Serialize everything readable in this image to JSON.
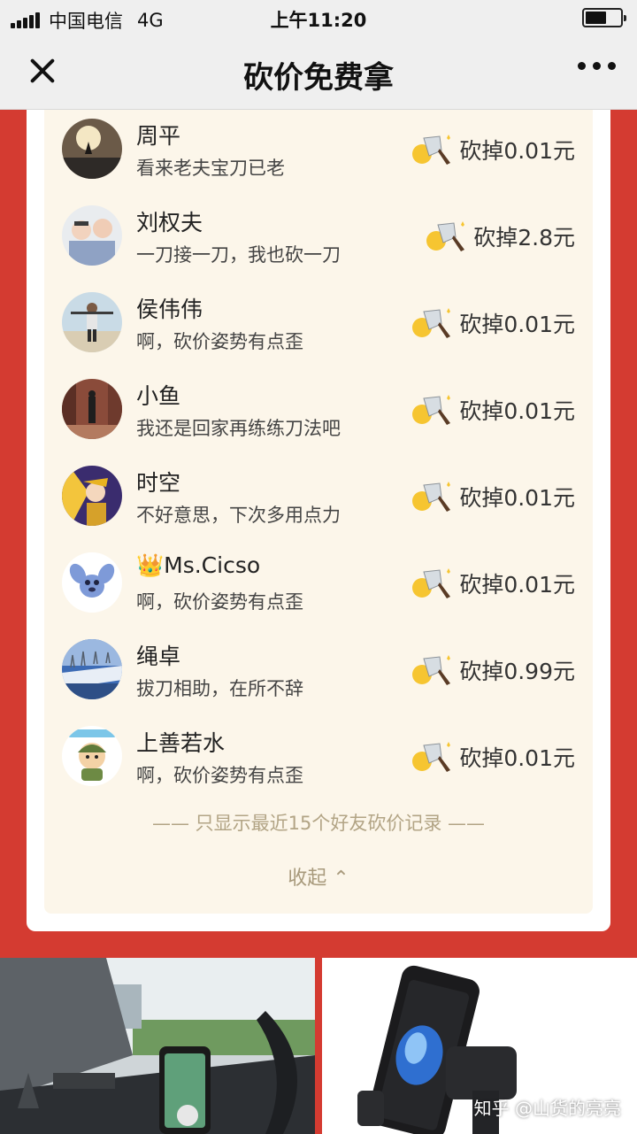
{
  "status_bar": {
    "carrier": "中国电信",
    "network": "4G",
    "time": "上午11:20",
    "battery_level": 0.6
  },
  "nav": {
    "title": "砍价免费拿"
  },
  "records": [
    {
      "name": "周平",
      "comment": "看来老夫宝刀已老",
      "cut": "砍掉0.01元",
      "avatar": "avatar-sunset"
    },
    {
      "name": "刘权夫",
      "comment": "一刀接一刀，我也砍一刀",
      "cut": "砍掉2.8元",
      "avatar": "avatar-kids"
    },
    {
      "name": "侯伟伟",
      "comment": "啊，砍价姿势有点歪",
      "cut": "砍掉0.01元",
      "avatar": "avatar-beach"
    },
    {
      "name": "小鱼",
      "comment": "我还是回家再练练刀法吧",
      "cut": "砍掉0.01元",
      "avatar": "avatar-street"
    },
    {
      "name": "时空",
      "comment": "不好意思，下次多用点力",
      "cut": "砍掉0.01元",
      "avatar": "avatar-anime"
    },
    {
      "name": "👑Ms.Cicso",
      "comment": "啊，砍价姿势有点歪",
      "cut": "砍掉0.01元",
      "avatar": "avatar-stitch"
    },
    {
      "name": "绳卓",
      "comment": "拔刀相助，在所不辞",
      "cut": "砍掉0.99元",
      "avatar": "avatar-sky"
    },
    {
      "name": "上善若水",
      "comment": "啊，砍价姿势有点歪",
      "cut": "砍掉0.01元",
      "avatar": "avatar-cartoon"
    }
  ],
  "footer_note": "—— 只显示最近15个好友砍价记录 ——",
  "collapse_label": "收起 ⌃",
  "watermark": "知乎 @山货的亮亮",
  "colors": {
    "page_red": "#d43b31",
    "card_bg": "#fcf6ea",
    "muted_text": "#b2a485"
  }
}
